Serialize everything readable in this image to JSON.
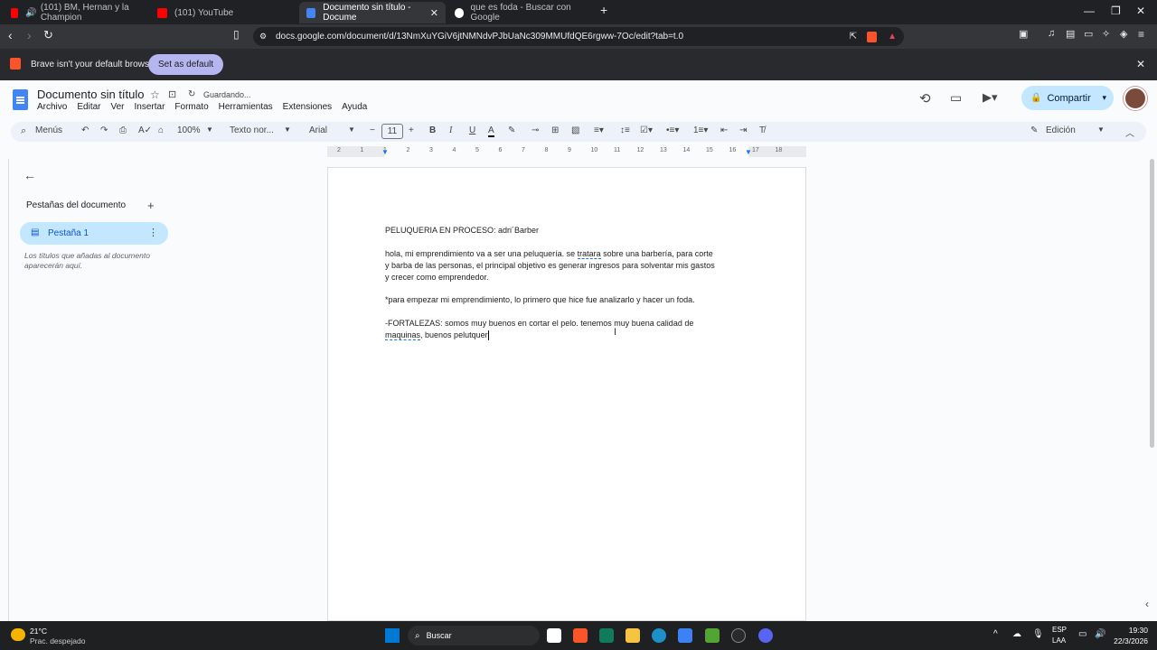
{
  "browser": {
    "tabs": [
      {
        "label": "(101) BM, Hernan y la Champion"
      },
      {
        "label": "(101) YouTube"
      },
      {
        "label": "Documento sin título - Docume"
      },
      {
        "label": "que es foda - Buscar con Google"
      }
    ],
    "url": "docs.google.com/document/d/13NmXuYGiV6jtNMNdvPJbUaNc309MMUfdQE6rgww-7Oc/edit?tab=t.0",
    "notice": "Brave isn't your default browser",
    "notice_button": "Set as default"
  },
  "docs": {
    "title": "Documento sin título",
    "saving": "Guardando...",
    "menus": [
      "Archivo",
      "Editar",
      "Ver",
      "Insertar",
      "Formato",
      "Herramientas",
      "Extensiones",
      "Ayuda"
    ],
    "share": "Compartir",
    "toolbar": {
      "search": "Menús",
      "zoom": "100%",
      "style": "Texto nor...",
      "font": "Arial",
      "size": "11",
      "mode": "Edición"
    },
    "ruler_ticks": [
      "2",
      "1",
      "1",
      "2",
      "3",
      "4",
      "5",
      "6",
      "7",
      "8",
      "9",
      "10",
      "11",
      "12",
      "13",
      "14",
      "15",
      "16",
      "17",
      "18"
    ],
    "sidebar": {
      "heading": "Pestañas del documento",
      "tab": "Pestaña 1",
      "hint": "Los títulos que añadas al documento aparecerán aquí."
    },
    "content": {
      "heading": " PELUQUERIA EN PROCESO: adri´Barber",
      "p1_a": "hola, mi emprendimiento va a ser una peluquería. se ",
      "p1_b": "tratara",
      "p1_c": " sobre una barbería, para corte",
      "p1_l2": "y barba de las personas, el principal objetivo es generar ingresos para solventar mis gastos",
      "p1_l3": "y crecer como emprendedor.",
      "p2": "*para empezar mi emprendimiento, lo primero que hice fue analizarlo y hacer un foda.",
      "p3_l1": "-FORTALEZAS: somos muy buenos en cortar el pelo. tenemos muy buena calidad de",
      "p3_b": "maquinas",
      "p3_c": ", buenos pelutquer"
    }
  },
  "taskbar": {
    "weather_temp": "21°C",
    "weather_desc": "Prac. despejado",
    "search": "Buscar",
    "lang1": "ESP",
    "lang2": "LAA",
    "time": "19:30",
    "date": "22/3/2026"
  }
}
